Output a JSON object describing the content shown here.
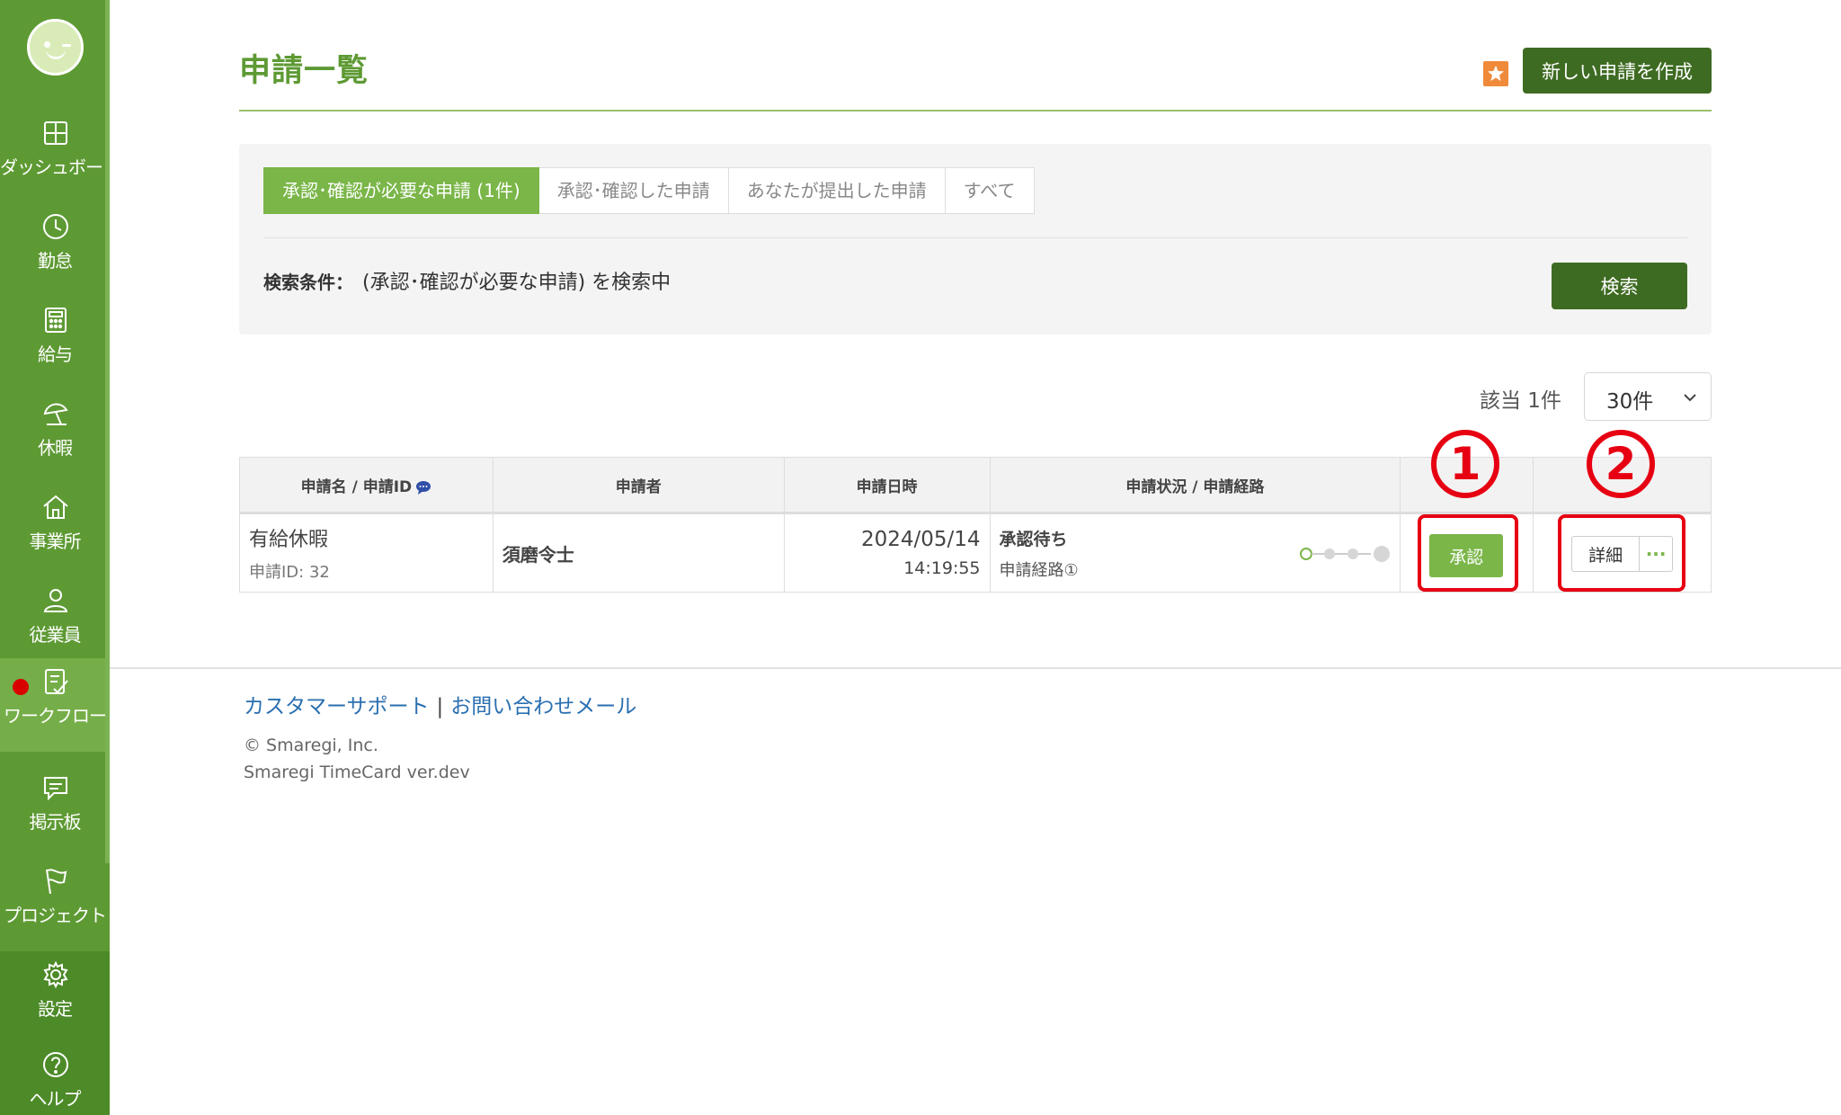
{
  "sidebar": {
    "items": [
      {
        "label": "ダッシュボード",
        "icon": "dashboard-icon"
      },
      {
        "label": "勤怠",
        "icon": "clock-icon"
      },
      {
        "label": "給与",
        "icon": "calculator-icon"
      },
      {
        "label": "休暇",
        "icon": "beach-umbrella-icon"
      },
      {
        "label": "事業所",
        "icon": "home-icon"
      },
      {
        "label": "従業員",
        "icon": "person-icon"
      },
      {
        "label": "ワークフロー",
        "icon": "checklist-icon"
      },
      {
        "label": "掲示板",
        "icon": "message-board-icon"
      },
      {
        "label": "プロジェクト",
        "icon": "flag-icon"
      },
      {
        "label": "設定",
        "icon": "gear-icon"
      },
      {
        "label": "ヘルプ",
        "icon": "help-icon"
      }
    ]
  },
  "header": {
    "title": "申請一覧",
    "new_button": "新しい申請を作成"
  },
  "filters": {
    "tabs": [
      {
        "label": "承認･確認が必要な申請 (1件)",
        "active": true
      },
      {
        "label": "承認･確認した申請",
        "active": false
      },
      {
        "label": "あなたが提出した申請",
        "active": false
      },
      {
        "label": "すべて",
        "active": false
      }
    ],
    "condition_label": "検索条件：",
    "condition_value": "(承認･確認が必要な申請) を検索中",
    "search_button": "検索"
  },
  "results": {
    "count_text": "該当 1件",
    "per_page": "30件"
  },
  "table": {
    "headers": [
      "申請名 / 申請ID",
      "申請者",
      "申請日時",
      "申請状況 / 申請経路",
      "",
      ""
    ],
    "rows": [
      {
        "name": "有給休暇",
        "id_text": "申請ID: 32",
        "applicant": "須磨令士",
        "date": "2024/05/14",
        "time": "14:19:55",
        "status": "承認待ち",
        "route": "申請経路①",
        "approve_button": "承認",
        "detail_button": "詳細",
        "more_button": "···"
      }
    ]
  },
  "annotations": {
    "marker_1": "1",
    "marker_2": "2",
    "color": "#e60012"
  },
  "footer": {
    "support_link": "カスタマーサポート",
    "separator": "|",
    "contact_link": "お問い合わせメール",
    "copyright": "© Smaregi, Inc.",
    "version": "Smaregi TimeCard ver.dev"
  },
  "colors": {
    "sidebar": "#5e9a34",
    "accent_green": "#7ab648",
    "dark_green": "#3e6b22",
    "link_blue": "#2a6fb0"
  }
}
